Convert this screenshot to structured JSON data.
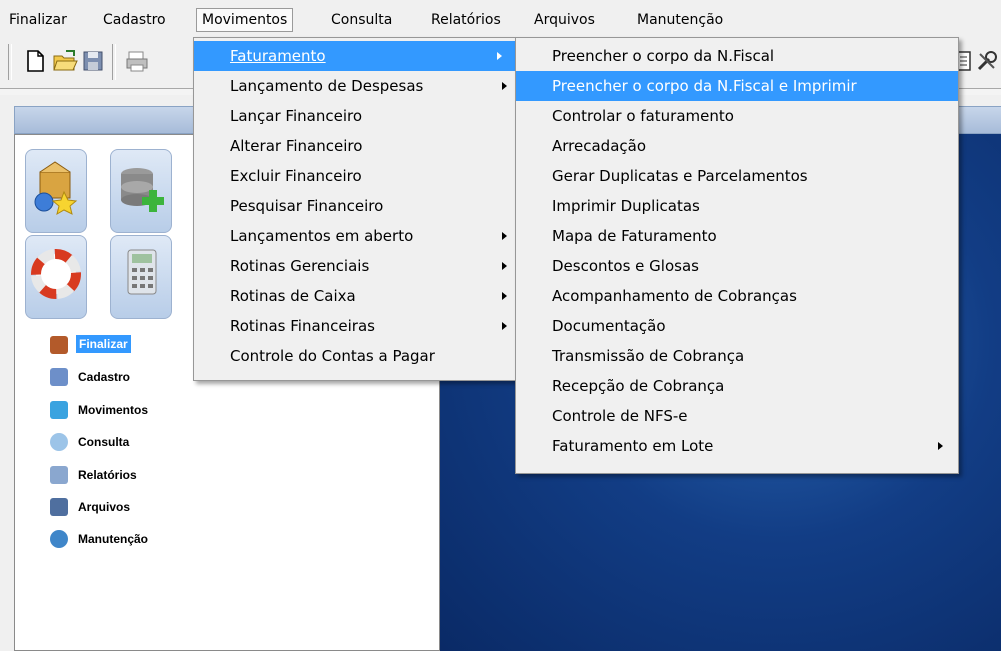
{
  "menubar": {
    "items": [
      "Finalizar",
      "Cadastro",
      "Movimentos",
      "Consulta",
      "Relatórios",
      "Arquivos",
      "Manutenção"
    ],
    "active_index": 2
  },
  "toolbar": {
    "buttons": [
      "new-document-icon",
      "open-folder-icon",
      "save-icon",
      "print-icon"
    ],
    "right_buttons": [
      "document-icon",
      "tools-icon"
    ]
  },
  "sidebar": {
    "big_icons": [
      "package-globe-icon",
      "database-add-icon",
      "lifebuoy-icon",
      "calculator-icon"
    ],
    "items": [
      {
        "label": "Finalizar",
        "icon": "power-icon",
        "selected": true
      },
      {
        "label": "Cadastro",
        "icon": "book-icon"
      },
      {
        "label": "Movimentos",
        "icon": "people-icon"
      },
      {
        "label": "Consulta",
        "icon": "magnifier-icon"
      },
      {
        "label": "Relatórios",
        "icon": "printer-icon"
      },
      {
        "label": "Arquivos",
        "icon": "floppy-icon"
      },
      {
        "label": "Manutenção",
        "icon": "gears-icon"
      }
    ]
  },
  "movimentos_menu": [
    {
      "label": "Faturamento",
      "submenu": true,
      "highlight": true
    },
    {
      "label": "Lançamento de Despesas",
      "submenu": true
    },
    {
      "label": "Lançar Financeiro",
      "submenu": false
    },
    {
      "label": "Alterar Financeiro",
      "submenu": false
    },
    {
      "label": "Excluir Financeiro",
      "submenu": false
    },
    {
      "label": "Pesquisar Financeiro",
      "submenu": false
    },
    {
      "label": "Lançamentos em aberto",
      "submenu": true
    },
    {
      "label": "Rotinas Gerenciais",
      "submenu": true
    },
    {
      "label": "Rotinas de Caixa",
      "submenu": true
    },
    {
      "label": "Rotinas Financeiras",
      "submenu": true
    },
    {
      "label": "Controle do Contas a Pagar",
      "submenu": false
    }
  ],
  "faturamento_menu": [
    {
      "label": "Preencher o corpo da N.Fiscal",
      "submenu": false
    },
    {
      "label": "Preencher o corpo da N.Fiscal e Imprimir",
      "submenu": false,
      "highlight": true
    },
    {
      "label": "Controlar o faturamento",
      "submenu": false
    },
    {
      "label": "Arrecadação",
      "submenu": false
    },
    {
      "label": "Gerar Duplicatas e Parcelamentos",
      "submenu": false
    },
    {
      "label": "Imprimir Duplicatas",
      "submenu": false
    },
    {
      "label": "Mapa de Faturamento",
      "submenu": false
    },
    {
      "label": "Descontos e Glosas",
      "submenu": false
    },
    {
      "label": "Acompanhamento de Cobranças",
      "submenu": false
    },
    {
      "label": "Documentação",
      "submenu": false
    },
    {
      "label": "Transmissão de Cobrança",
      "submenu": false
    },
    {
      "label": "Recepção de Cobrança",
      "submenu": false
    },
    {
      "label": "Controle de NFS-e",
      "submenu": false
    },
    {
      "label": "Faturamento em Lote",
      "submenu": true
    }
  ]
}
